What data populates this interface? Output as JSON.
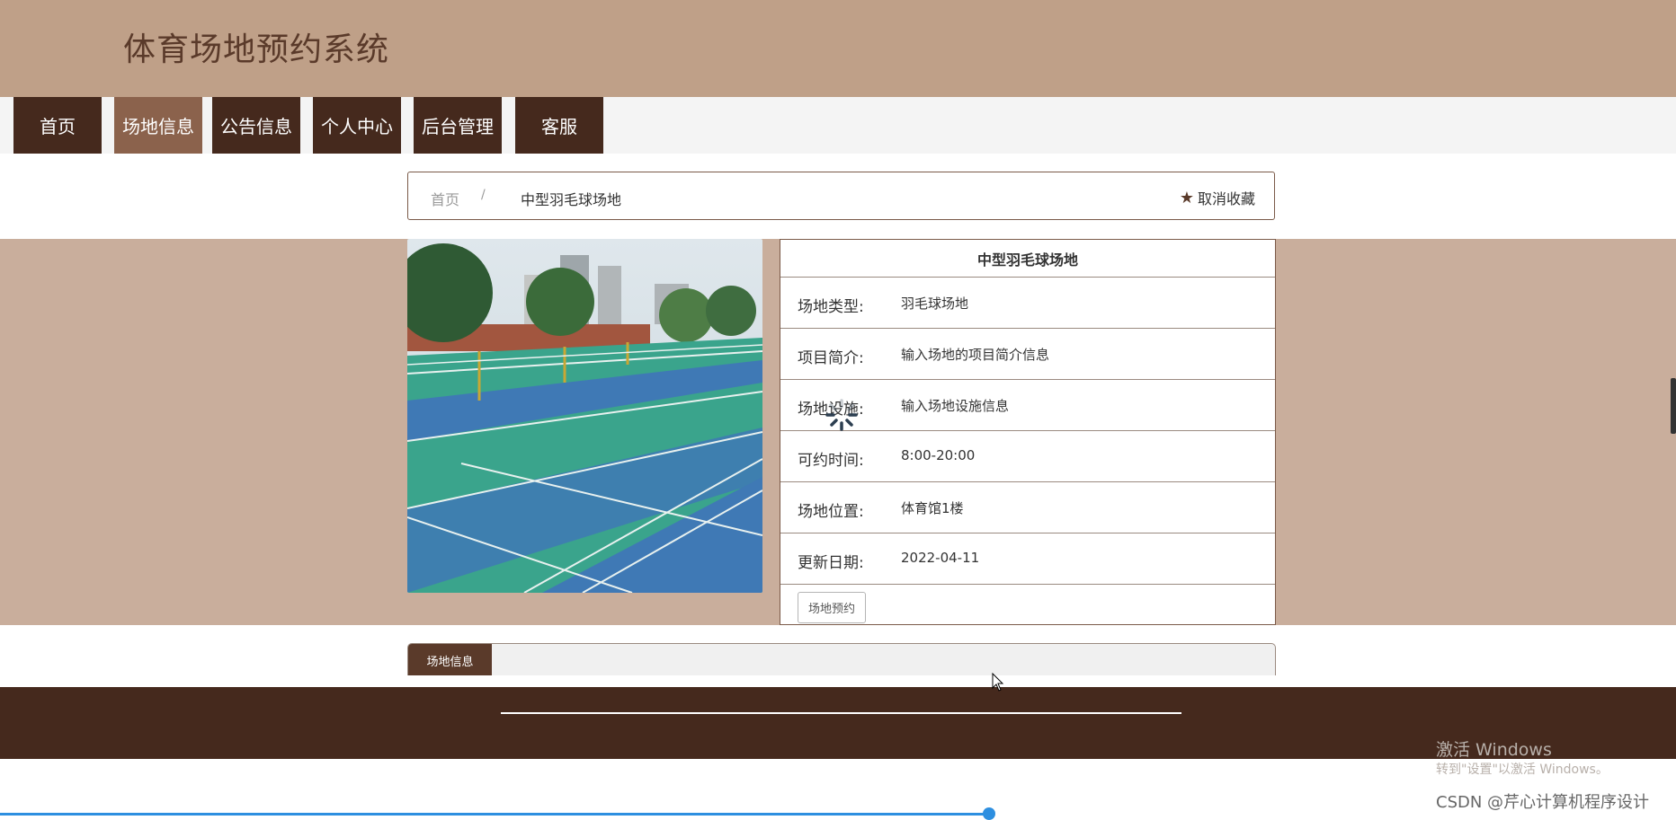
{
  "header": {
    "title": "体育场地预约系统"
  },
  "nav": {
    "items": [
      {
        "label": "首页",
        "active": false
      },
      {
        "label": "场地信息",
        "active": true
      },
      {
        "label": "公告信息",
        "active": false
      },
      {
        "label": "个人中心",
        "active": false
      },
      {
        "label": "后台管理",
        "active": false
      },
      {
        "label": "客服",
        "active": false
      }
    ]
  },
  "breadcrumb": {
    "home": "首页",
    "separator": "/",
    "current": "中型羽毛球场地",
    "favorite_label": "取消收藏",
    "favorite_icon": "star-icon"
  },
  "venue": {
    "title": "中型羽毛球场地",
    "rows": [
      {
        "label": "场地类型:",
        "value": "羽毛球场地"
      },
      {
        "label": "项目简介:",
        "value": "输入场地的项目简介信息"
      },
      {
        "label": "场地设施:",
        "value": "输入场地设施信息"
      },
      {
        "label": "可约时间:",
        "value": "8:00-20:00"
      },
      {
        "label": "场地位置:",
        "value": "体育馆1楼"
      },
      {
        "label": "更新日期:",
        "value": "2022-04-11"
      }
    ],
    "book_label": "场地预约"
  },
  "tabs": {
    "active_label": "场地信息"
  },
  "watermark": {
    "line1": "激活 Windows",
    "line2": "转到\"设置\"以激活 Windows。",
    "credit": "CSDN @芹心计算机程序设计"
  },
  "colors": {
    "header_bg": "#bfa088",
    "nav_bg": "#45291d",
    "nav_active_bg": "#8b624c",
    "band_bg": "#c9ae9c",
    "footer_bg": "#45291d"
  },
  "page_progress": 0.59
}
